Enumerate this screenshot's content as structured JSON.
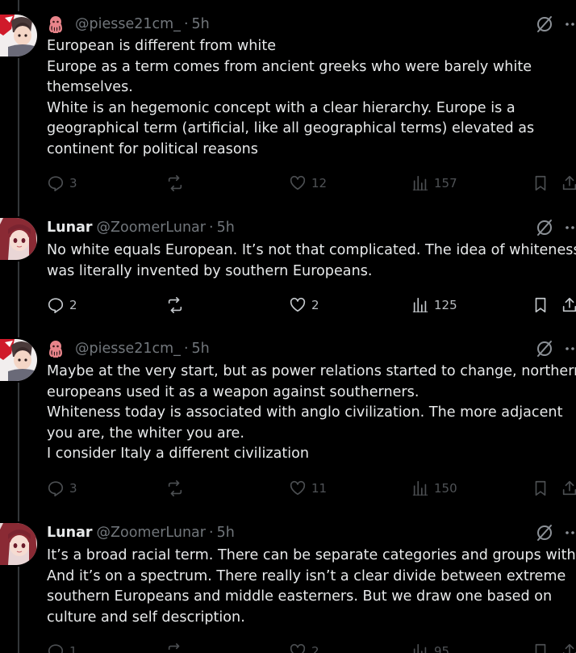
{
  "tweets": [
    {
      "display_name": "",
      "handle": "@piesse21cm_",
      "separator": "·",
      "time": "5h",
      "lines": [
        "European is different from white",
        "Europe as a term comes from ancient greeks who were barely white",
        "themselves.",
        "White is an hegemonic concept with a clear hierarchy. Europe is a",
        "geographical term (artificial, like all geographical terms) elevated as",
        "continent for political reasons"
      ],
      "replies": "3",
      "reposts": "",
      "likes": "12",
      "views": "157"
    },
    {
      "display_name": "Lunar",
      "handle": "@ZoomerLunar",
      "separator": "·",
      "time": "5h",
      "lines": [
        "No white equals European. It’s not that complicated. The idea of whiteness",
        "was literally invented by southern Europeans."
      ],
      "replies": "2",
      "reposts": "",
      "likes": "2",
      "views": "125"
    },
    {
      "display_name": "",
      "handle": "@piesse21cm_",
      "separator": "·",
      "time": "5h",
      "lines": [
        "Maybe at the very start, but as power relations started to change, northern",
        "europeans used it as a weapon against southerners.",
        "Whiteness today is associated with anglo civilization. The more adjacent",
        "you are, the whiter you are.",
        "I consider Italy a different civilization"
      ],
      "replies": "3",
      "reposts": "",
      "likes": "11",
      "views": "150"
    },
    {
      "display_name": "Lunar",
      "handle": "@ZoomerLunar",
      "separator": "·",
      "time": "5h",
      "lines": [
        "It’s a broad racial term. There can be separate categories and groups within.",
        "And it’s on a spectrum. There really isn’t a clear divide between extreme",
        "southern Europeans and middle easterners. But we draw one based on",
        "culture and self description."
      ],
      "replies": "1",
      "reposts": "",
      "likes": "2",
      "views": "95"
    }
  ],
  "icons": {
    "reply": "reply-icon",
    "repost": "repost-icon",
    "like": "heart-icon",
    "views": "views-chart-icon",
    "bookmark": "bookmark-icon",
    "share": "share-icon",
    "grok": "grok-icon",
    "more": "more-icon"
  },
  "colors": {
    "background": "#000000",
    "text": "#e7e9ea",
    "muted": "#71767b",
    "thread_line": "#333639"
  }
}
